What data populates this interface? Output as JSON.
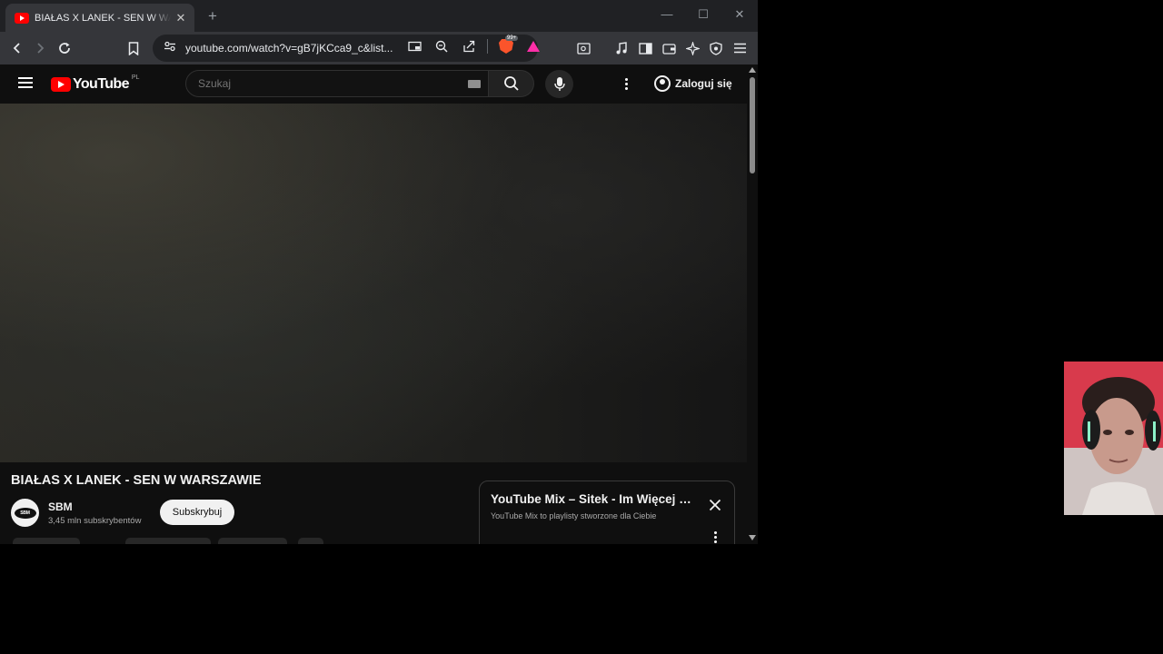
{
  "browser": {
    "tab": {
      "title": "BIAŁAS X LANEK - SEN W WARSZAWIE",
      "close_label": "✕"
    },
    "new_tab_label": "+",
    "window_controls": {
      "minimize": "—",
      "maximize": "☐",
      "close": "✕"
    },
    "url": "youtube.com/watch?v=gB7jKCca9_c&list...",
    "brave_shield_badge": "99+"
  },
  "youtube": {
    "logo_text": "YouTube",
    "country_code": "PL",
    "search": {
      "placeholder": "Szukaj"
    },
    "signin_label": "Zaloguj się",
    "video": {
      "title": "BIAŁAS X LANEK - SEN W WARSZAWIE",
      "channel_name": "SBM",
      "channel_avatar_text": "SBM",
      "subscribers": "3,45 mln subskrybentów",
      "subscribe_label": "Subskrybuj"
    },
    "mix_panel": {
      "title": "YouTube Mix – Sitek - Im Więcej Ciebie Tym Mniej",
      "subtitle": "YouTube Mix to playlisty stworzone dla Ciebie"
    }
  },
  "colors": {
    "youtube_red": "#ff0000",
    "background": "#0f0f0f",
    "brave_orange": "#fb542b"
  }
}
